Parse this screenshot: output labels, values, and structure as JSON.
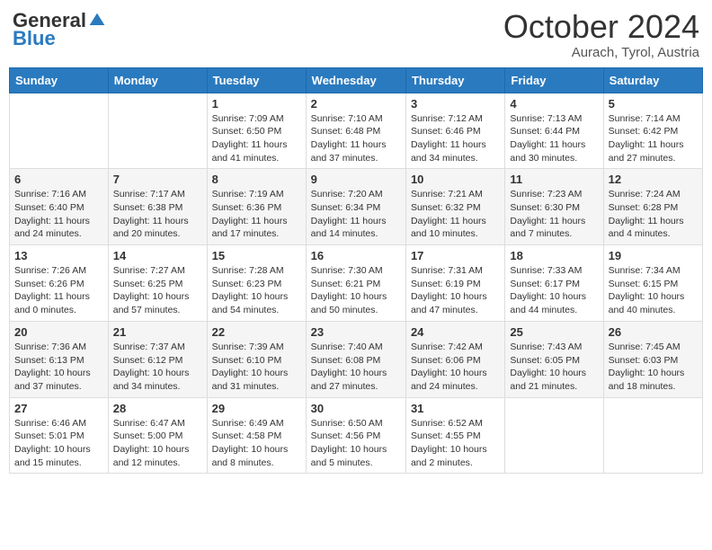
{
  "header": {
    "logo_general": "General",
    "logo_blue": "Blue",
    "month_title": "October 2024",
    "subtitle": "Aurach, Tyrol, Austria"
  },
  "days_of_week": [
    "Sunday",
    "Monday",
    "Tuesday",
    "Wednesday",
    "Thursday",
    "Friday",
    "Saturday"
  ],
  "weeks": [
    [
      {
        "day": "",
        "sunrise": "",
        "sunset": "",
        "daylight": ""
      },
      {
        "day": "",
        "sunrise": "",
        "sunset": "",
        "daylight": ""
      },
      {
        "day": "1",
        "sunrise": "Sunrise: 7:09 AM",
        "sunset": "Sunset: 6:50 PM",
        "daylight": "Daylight: 11 hours and 41 minutes."
      },
      {
        "day": "2",
        "sunrise": "Sunrise: 7:10 AM",
        "sunset": "Sunset: 6:48 PM",
        "daylight": "Daylight: 11 hours and 37 minutes."
      },
      {
        "day": "3",
        "sunrise": "Sunrise: 7:12 AM",
        "sunset": "Sunset: 6:46 PM",
        "daylight": "Daylight: 11 hours and 34 minutes."
      },
      {
        "day": "4",
        "sunrise": "Sunrise: 7:13 AM",
        "sunset": "Sunset: 6:44 PM",
        "daylight": "Daylight: 11 hours and 30 minutes."
      },
      {
        "day": "5",
        "sunrise": "Sunrise: 7:14 AM",
        "sunset": "Sunset: 6:42 PM",
        "daylight": "Daylight: 11 hours and 27 minutes."
      }
    ],
    [
      {
        "day": "6",
        "sunrise": "Sunrise: 7:16 AM",
        "sunset": "Sunset: 6:40 PM",
        "daylight": "Daylight: 11 hours and 24 minutes."
      },
      {
        "day": "7",
        "sunrise": "Sunrise: 7:17 AM",
        "sunset": "Sunset: 6:38 PM",
        "daylight": "Daylight: 11 hours and 20 minutes."
      },
      {
        "day": "8",
        "sunrise": "Sunrise: 7:19 AM",
        "sunset": "Sunset: 6:36 PM",
        "daylight": "Daylight: 11 hours and 17 minutes."
      },
      {
        "day": "9",
        "sunrise": "Sunrise: 7:20 AM",
        "sunset": "Sunset: 6:34 PM",
        "daylight": "Daylight: 11 hours and 14 minutes."
      },
      {
        "day": "10",
        "sunrise": "Sunrise: 7:21 AM",
        "sunset": "Sunset: 6:32 PM",
        "daylight": "Daylight: 11 hours and 10 minutes."
      },
      {
        "day": "11",
        "sunrise": "Sunrise: 7:23 AM",
        "sunset": "Sunset: 6:30 PM",
        "daylight": "Daylight: 11 hours and 7 minutes."
      },
      {
        "day": "12",
        "sunrise": "Sunrise: 7:24 AM",
        "sunset": "Sunset: 6:28 PM",
        "daylight": "Daylight: 11 hours and 4 minutes."
      }
    ],
    [
      {
        "day": "13",
        "sunrise": "Sunrise: 7:26 AM",
        "sunset": "Sunset: 6:26 PM",
        "daylight": "Daylight: 11 hours and 0 minutes."
      },
      {
        "day": "14",
        "sunrise": "Sunrise: 7:27 AM",
        "sunset": "Sunset: 6:25 PM",
        "daylight": "Daylight: 10 hours and 57 minutes."
      },
      {
        "day": "15",
        "sunrise": "Sunrise: 7:28 AM",
        "sunset": "Sunset: 6:23 PM",
        "daylight": "Daylight: 10 hours and 54 minutes."
      },
      {
        "day": "16",
        "sunrise": "Sunrise: 7:30 AM",
        "sunset": "Sunset: 6:21 PM",
        "daylight": "Daylight: 10 hours and 50 minutes."
      },
      {
        "day": "17",
        "sunrise": "Sunrise: 7:31 AM",
        "sunset": "Sunset: 6:19 PM",
        "daylight": "Daylight: 10 hours and 47 minutes."
      },
      {
        "day": "18",
        "sunrise": "Sunrise: 7:33 AM",
        "sunset": "Sunset: 6:17 PM",
        "daylight": "Daylight: 10 hours and 44 minutes."
      },
      {
        "day": "19",
        "sunrise": "Sunrise: 7:34 AM",
        "sunset": "Sunset: 6:15 PM",
        "daylight": "Daylight: 10 hours and 40 minutes."
      }
    ],
    [
      {
        "day": "20",
        "sunrise": "Sunrise: 7:36 AM",
        "sunset": "Sunset: 6:13 PM",
        "daylight": "Daylight: 10 hours and 37 minutes."
      },
      {
        "day": "21",
        "sunrise": "Sunrise: 7:37 AM",
        "sunset": "Sunset: 6:12 PM",
        "daylight": "Daylight: 10 hours and 34 minutes."
      },
      {
        "day": "22",
        "sunrise": "Sunrise: 7:39 AM",
        "sunset": "Sunset: 6:10 PM",
        "daylight": "Daylight: 10 hours and 31 minutes."
      },
      {
        "day": "23",
        "sunrise": "Sunrise: 7:40 AM",
        "sunset": "Sunset: 6:08 PM",
        "daylight": "Daylight: 10 hours and 27 minutes."
      },
      {
        "day": "24",
        "sunrise": "Sunrise: 7:42 AM",
        "sunset": "Sunset: 6:06 PM",
        "daylight": "Daylight: 10 hours and 24 minutes."
      },
      {
        "day": "25",
        "sunrise": "Sunrise: 7:43 AM",
        "sunset": "Sunset: 6:05 PM",
        "daylight": "Daylight: 10 hours and 21 minutes."
      },
      {
        "day": "26",
        "sunrise": "Sunrise: 7:45 AM",
        "sunset": "Sunset: 6:03 PM",
        "daylight": "Daylight: 10 hours and 18 minutes."
      }
    ],
    [
      {
        "day": "27",
        "sunrise": "Sunrise: 6:46 AM",
        "sunset": "Sunset: 5:01 PM",
        "daylight": "Daylight: 10 hours and 15 minutes."
      },
      {
        "day": "28",
        "sunrise": "Sunrise: 6:47 AM",
        "sunset": "Sunset: 5:00 PM",
        "daylight": "Daylight: 10 hours and 12 minutes."
      },
      {
        "day": "29",
        "sunrise": "Sunrise: 6:49 AM",
        "sunset": "Sunset: 4:58 PM",
        "daylight": "Daylight: 10 hours and 8 minutes."
      },
      {
        "day": "30",
        "sunrise": "Sunrise: 6:50 AM",
        "sunset": "Sunset: 4:56 PM",
        "daylight": "Daylight: 10 hours and 5 minutes."
      },
      {
        "day": "31",
        "sunrise": "Sunrise: 6:52 AM",
        "sunset": "Sunset: 4:55 PM",
        "daylight": "Daylight: 10 hours and 2 minutes."
      },
      {
        "day": "",
        "sunrise": "",
        "sunset": "",
        "daylight": ""
      },
      {
        "day": "",
        "sunrise": "",
        "sunset": "",
        "daylight": ""
      }
    ]
  ]
}
